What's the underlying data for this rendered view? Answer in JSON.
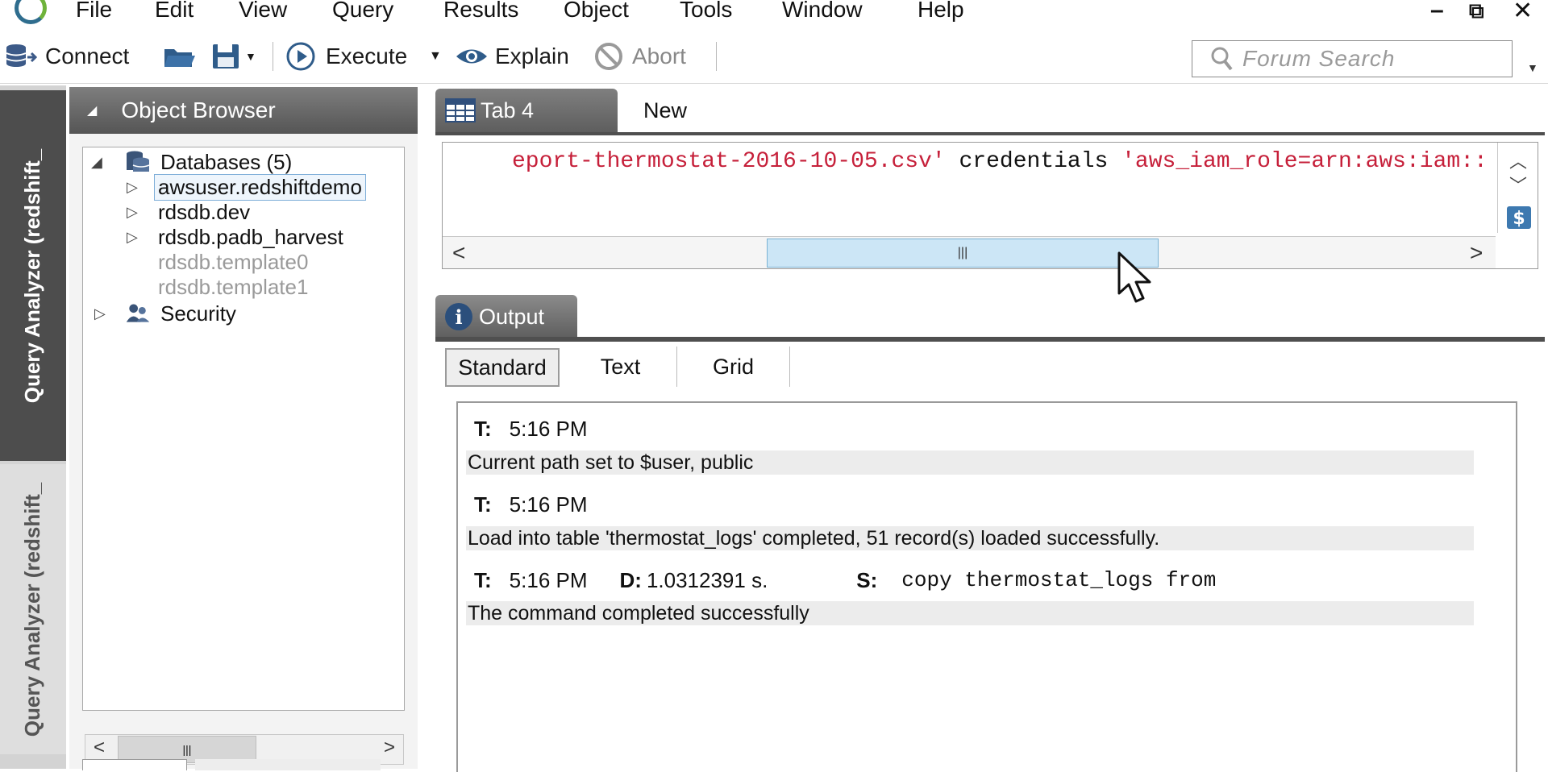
{
  "menu": [
    "File",
    "Edit",
    "View",
    "Query",
    "Results",
    "Object",
    "Tools",
    "Window",
    "Help"
  ],
  "window_controls": {
    "minimize": "–",
    "restore": "⧉",
    "close": "✕"
  },
  "toolbar": {
    "connect": "Connect",
    "execute": "Execute",
    "explain": "Explain",
    "abort": "Abort",
    "search_placeholder": "Forum Search"
  },
  "side_tabs": {
    "active": "Query Analyzer (redshift_",
    "inactive": "Query Analyzer (redshift_"
  },
  "object_browser": {
    "title": "Object Browser",
    "databases_label": "Databases (5)",
    "databases": [
      {
        "name": "awsuser.redshiftdemo",
        "selected": true,
        "muted": false
      },
      {
        "name": "rdsdb.dev",
        "selected": false,
        "muted": false
      },
      {
        "name": "rdsdb.padb_harvest",
        "selected": false,
        "muted": false
      },
      {
        "name": "rdsdb.template0",
        "selected": false,
        "muted": true
      },
      {
        "name": "rdsdb.template1",
        "selected": false,
        "muted": true
      }
    ],
    "security_label": "Security"
  },
  "doc_tabs": {
    "active": "Tab 4",
    "new": "New"
  },
  "editor": {
    "str1": "eport-thermostat-2016-10-05.csv'",
    "kw": " credentials ",
    "str2": "'aws_iam_role=arn:aws:iam::"
  },
  "output": {
    "tab": "Output",
    "modes": [
      "Standard",
      "Text",
      "Grid"
    ],
    "active_mode": "Standard",
    "t_label": "T:",
    "d_label": "D:",
    "s_label": "S:",
    "messages": [
      {
        "time": "5:16 PM",
        "text": "Current path set to $user, public"
      },
      {
        "time": "5:16 PM",
        "text": "Load into table 'thermostat_logs' completed, 51 record(s) loaded successfully."
      },
      {
        "time": "5:16 PM",
        "duration": "1.0312391 s.",
        "sql": "copy thermostat_logs from",
        "text": "The command completed successfully"
      }
    ]
  },
  "colors": {
    "accent_tab": "#5e5e5e",
    "sql_string": "#c6203a",
    "scroll_thumb": "#cce6f6"
  }
}
